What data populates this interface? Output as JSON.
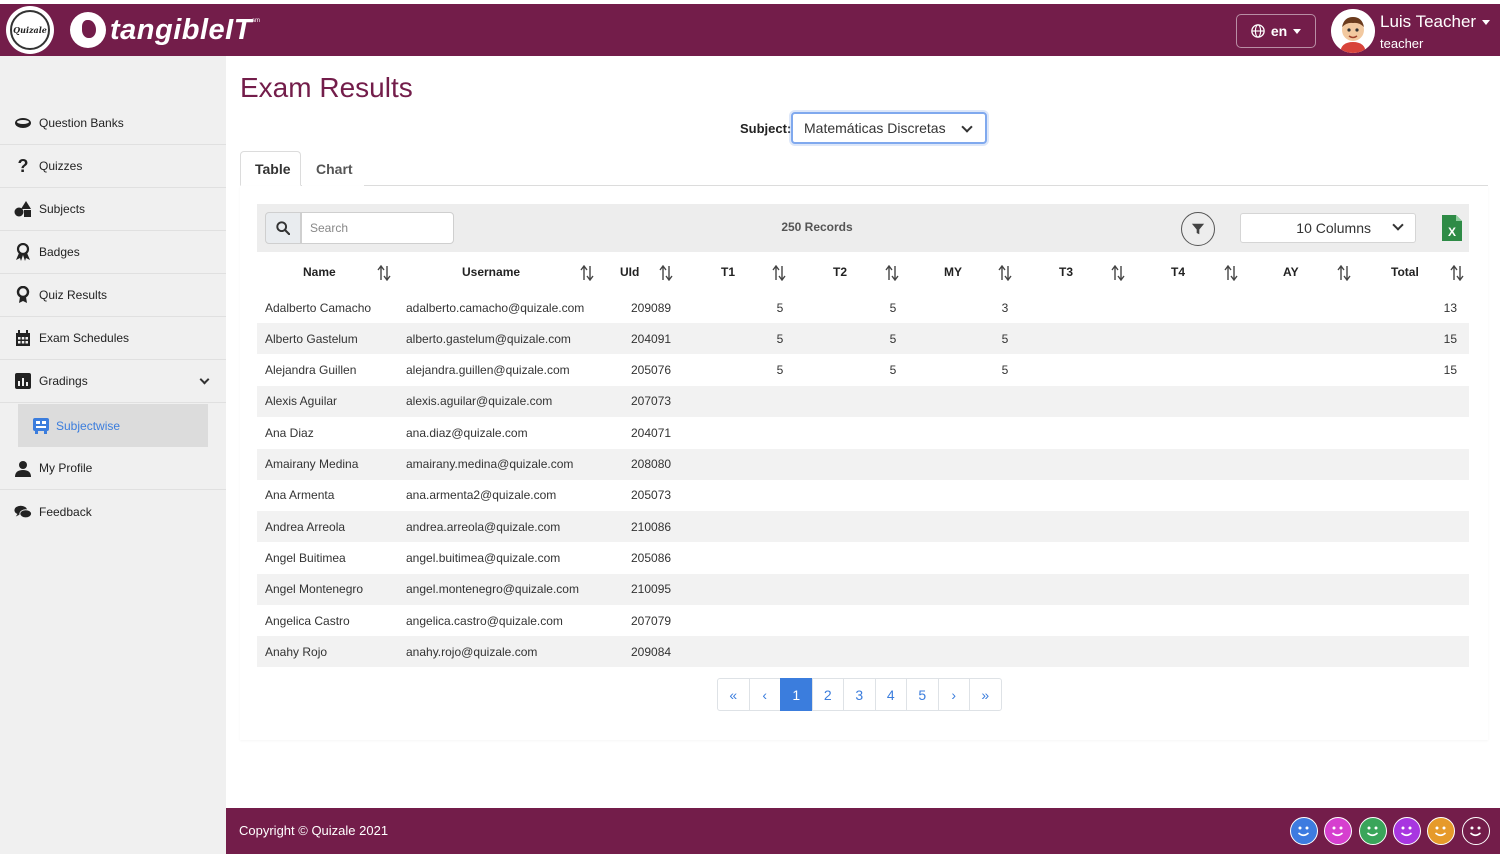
{
  "header": {
    "logo_text": "Quizale",
    "brand": "tangibleIT",
    "brand_mark": "sm",
    "language": "en",
    "user_name": "Luis Teacher",
    "user_role": "teacher"
  },
  "sidebar": {
    "items": [
      {
        "label": "Question Banks",
        "icon": "bank-icon"
      },
      {
        "label": "Quizzes",
        "icon": "question-icon"
      },
      {
        "label": "Subjects",
        "icon": "shapes-icon"
      },
      {
        "label": "Badges",
        "icon": "award-icon"
      },
      {
        "label": "Quiz Results",
        "icon": "medal-icon"
      },
      {
        "label": "Exam Schedules",
        "icon": "calendar-icon"
      },
      {
        "label": "Gradings",
        "icon": "chart-icon"
      },
      {
        "label": "My Profile",
        "icon": "user-icon"
      },
      {
        "label": "Feedback",
        "icon": "comments-icon"
      }
    ],
    "subitem": {
      "label": "Subjectwise",
      "icon": "subject-icon"
    }
  },
  "main": {
    "title": "Exam Results",
    "subject_label": "Subject:",
    "subject_value": "Matemáticas Discretas",
    "tabs": [
      {
        "label": "Table"
      },
      {
        "label": "Chart"
      }
    ],
    "search_placeholder": "Search",
    "records": "250 Records",
    "columns_select": "10 Columns",
    "headers": [
      "Name",
      "Username",
      "UId",
      "T1",
      "T2",
      "MY",
      "T3",
      "T4",
      "AY",
      "Total"
    ],
    "rows": [
      {
        "name": "Adalberto Camacho",
        "username": "adalberto.camacho@quizale.com",
        "uid": "209089",
        "t1": "5",
        "t2": "5",
        "my": "3",
        "total": "13"
      },
      {
        "name": "Alberto Gastelum",
        "username": "alberto.gastelum@quizale.com",
        "uid": "204091",
        "t1": "5",
        "t2": "5",
        "my": "5",
        "total": "15"
      },
      {
        "name": "Alejandra Guillen",
        "username": "alejandra.guillen@quizale.com",
        "uid": "205076",
        "t1": "5",
        "t2": "5",
        "my": "5",
        "total": "15"
      },
      {
        "name": "Alexis Aguilar",
        "username": "alexis.aguilar@quizale.com",
        "uid": "207073"
      },
      {
        "name": "Ana Diaz",
        "username": "ana.diaz@quizale.com",
        "uid": "204071"
      },
      {
        "name": "Amairany Medina",
        "username": "amairany.medina@quizale.com",
        "uid": "208080"
      },
      {
        "name": "Ana Armenta",
        "username": "ana.armenta2@quizale.com",
        "uid": "205073"
      },
      {
        "name": "Andrea Arreola",
        "username": "andrea.arreola@quizale.com",
        "uid": "210086"
      },
      {
        "name": "Angel Buitimea",
        "username": "angel.buitimea@quizale.com",
        "uid": "205086"
      },
      {
        "name": "Angel Montenegro",
        "username": "angel.montenegro@quizale.com",
        "uid": "210095"
      },
      {
        "name": "Angelica Castro",
        "username": "angelica.castro@quizale.com",
        "uid": "207079"
      },
      {
        "name": "Anahy Rojo",
        "username": "anahy.rojo@quizale.com",
        "uid": "209084"
      }
    ],
    "pagination": [
      "«",
      "‹",
      "1",
      "2",
      "3",
      "4",
      "5",
      "›",
      "»"
    ],
    "active_page": "1"
  },
  "footer": {
    "copyright": "Copyright © Quizale 2021",
    "smiley_colors": [
      "#3d7be0",
      "#d63fcf",
      "#3aa55a",
      "#a836e0",
      "#e69a2a",
      "#731d4a"
    ]
  },
  "colors": {
    "brand": "#731d4a",
    "accent": "#3b7ddd"
  }
}
